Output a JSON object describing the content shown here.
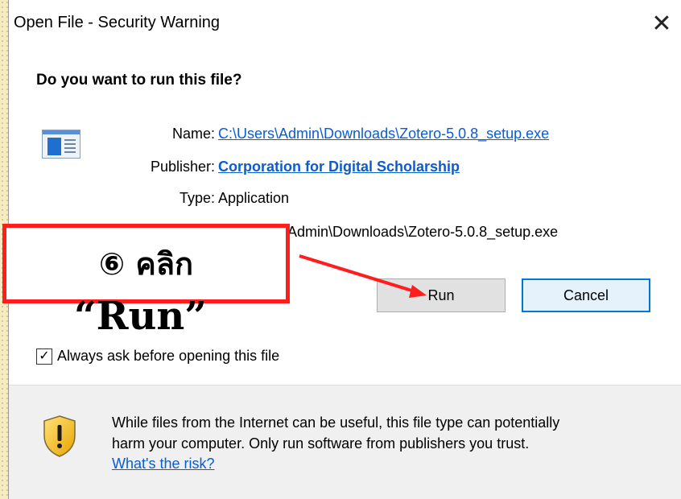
{
  "dialog": {
    "title": "Open File - Security Warning",
    "close_symbol": "✕",
    "question": "Do you want to run this file?",
    "file_icon": "application-window-icon",
    "name_label": "Name:",
    "name_value": "C:\\Users\\Admin\\Downloads\\Zotero-5.0.8_setup.exe",
    "publisher_label": "Publisher:",
    "publisher_value": "Corporation for Digital Scholarship",
    "type_label": "Type:",
    "type_value": "Application",
    "from_value": "Admin\\Downloads\\Zotero-5.0.8_setup.exe",
    "run_label": "Run",
    "cancel_label": "Cancel",
    "always_ask_label": "Always ask before opening this file",
    "always_ask_checked": true,
    "checkbox_mark": "✓",
    "warning_icon": "shield-warning-icon",
    "warning_text_1": "While files from the Internet can be useful, this file type can potentially",
    "warning_text_2": "harm your computer. Only run software from publishers you trust.",
    "risk_link": "What's the risk?"
  },
  "annotation": {
    "step_text": "⑥ คลิก",
    "run_quote": "“Run”",
    "highlight_color": "#ff1d1d"
  },
  "colors": {
    "link": "#0b5ccf",
    "cancel_border": "#0078d7",
    "background_pattern": "#f6ecc4"
  }
}
